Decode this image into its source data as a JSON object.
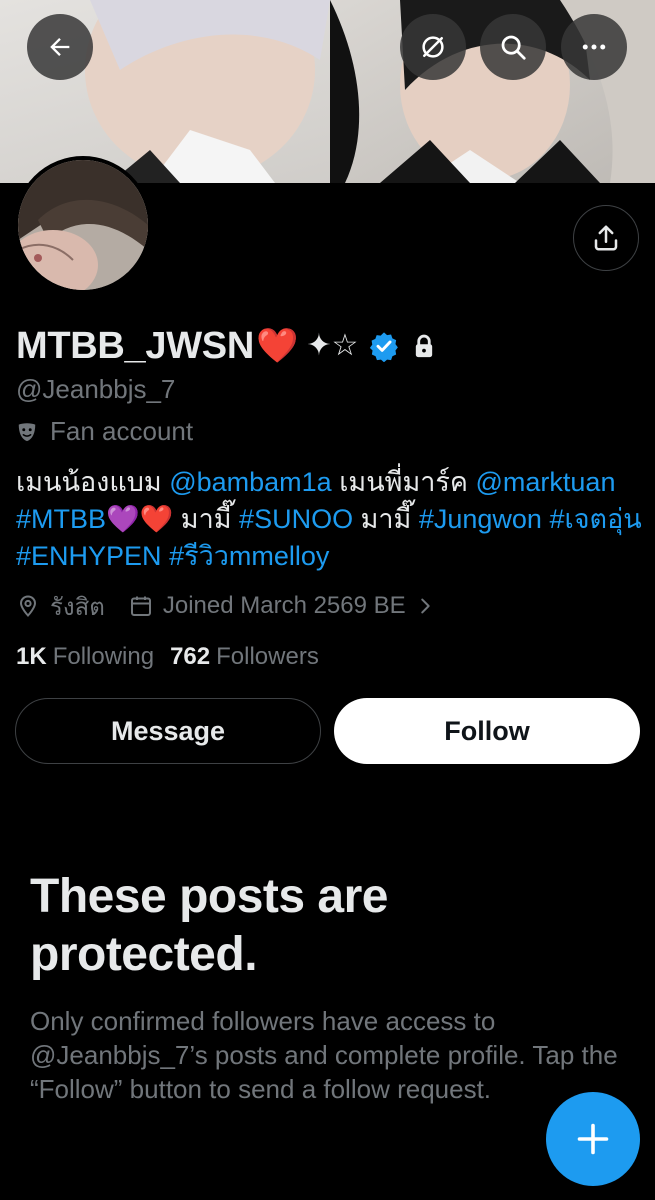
{
  "profile": {
    "display_name": "MTBB_JWSN",
    "name_emoji": "❤️",
    "name_symbols": "✦☆",
    "handle": "@Jeanbbjs_7",
    "category": "Fan account",
    "location": "รังสิต",
    "joined": "Joined March 2569 BE",
    "following_count": "1K",
    "following_label": "Following",
    "followers_count": "762",
    "followers_label": "Followers"
  },
  "bio": {
    "t1": "เมนน้องแบม ",
    "mention1": "@bambam1a",
    "t2": " เมนพี่มาร์ค ",
    "mention2": "@marktuan",
    "space": " ",
    "tag1": "#MTBB",
    "heart_purple": "💜",
    "heart_red": "❤️",
    "t3": " มามี๊ ",
    "tag2": "#SUNOO",
    "t4": " มามี๊ ",
    "tag3": "#Jungwon",
    "tag4": "#เจตอุ่น",
    "tag5": "#ENHYPEN",
    "tag6": "#รีวิวmmelloy"
  },
  "actions": {
    "message_label": "Message",
    "follow_label": "Follow"
  },
  "protected": {
    "title": "These posts are protected.",
    "description": "Only confirmed followers have access to @Jeanbbjs_7’s posts and complete profile. Tap the “Follow” button to send a follow request."
  },
  "icons": {
    "back": "back-arrow-icon",
    "unlink": "grok-icon",
    "search": "search-icon",
    "more": "more-icon",
    "share": "share-icon",
    "verified": "verified-badge-icon",
    "lock": "lock-icon",
    "category": "mask-icon",
    "location": "location-pin-icon",
    "calendar": "calendar-icon",
    "chevron": "chevron-right-icon",
    "compose": "plus-icon"
  },
  "colors": {
    "accent": "#1d9bf0",
    "background": "#000000",
    "secondary_text": "#71767b",
    "primary_text": "#e7e9ea"
  }
}
